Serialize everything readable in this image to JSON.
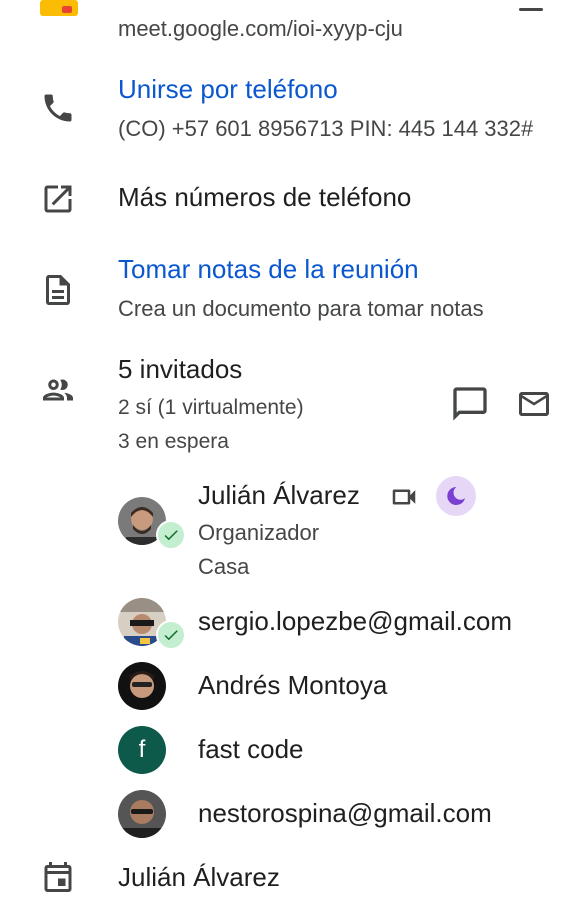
{
  "meet": {
    "link": "meet.google.com/ioi-xyyp-cju"
  },
  "phone": {
    "title": "Unirse por teléfono",
    "details": "(CO) +57 601 8956713 PIN: 445 144 332#"
  },
  "more_numbers": {
    "label": "Más números de teléfono"
  },
  "notes": {
    "title": "Tomar notas de la reunión",
    "subtitle": "Crea un documento para tomar notas"
  },
  "guests": {
    "count_label": "5 invitados",
    "yes_label": "2 sí (1 virtualmente)",
    "pending_label": "3 en espera",
    "list": [
      {
        "name": "Julián Álvarez",
        "role": "Organizador",
        "location": "Casa",
        "accepted": true
      },
      {
        "name": "sergio.lopezbe@gmail.com",
        "accepted": true
      },
      {
        "name": "Andrés Montoya",
        "accepted": false
      },
      {
        "name": "fast code",
        "initial": "f",
        "accepted": false
      },
      {
        "name": "nestorospina@gmail.com",
        "accepted": false
      }
    ]
  },
  "calendar": {
    "owner": "Julián Álvarez"
  },
  "colors": {
    "link": "#0b57d0",
    "accepted_badge": "#c4eed0",
    "dnd_chip": "#e6d7f7",
    "letter_avatar": "#0e5a4a"
  }
}
